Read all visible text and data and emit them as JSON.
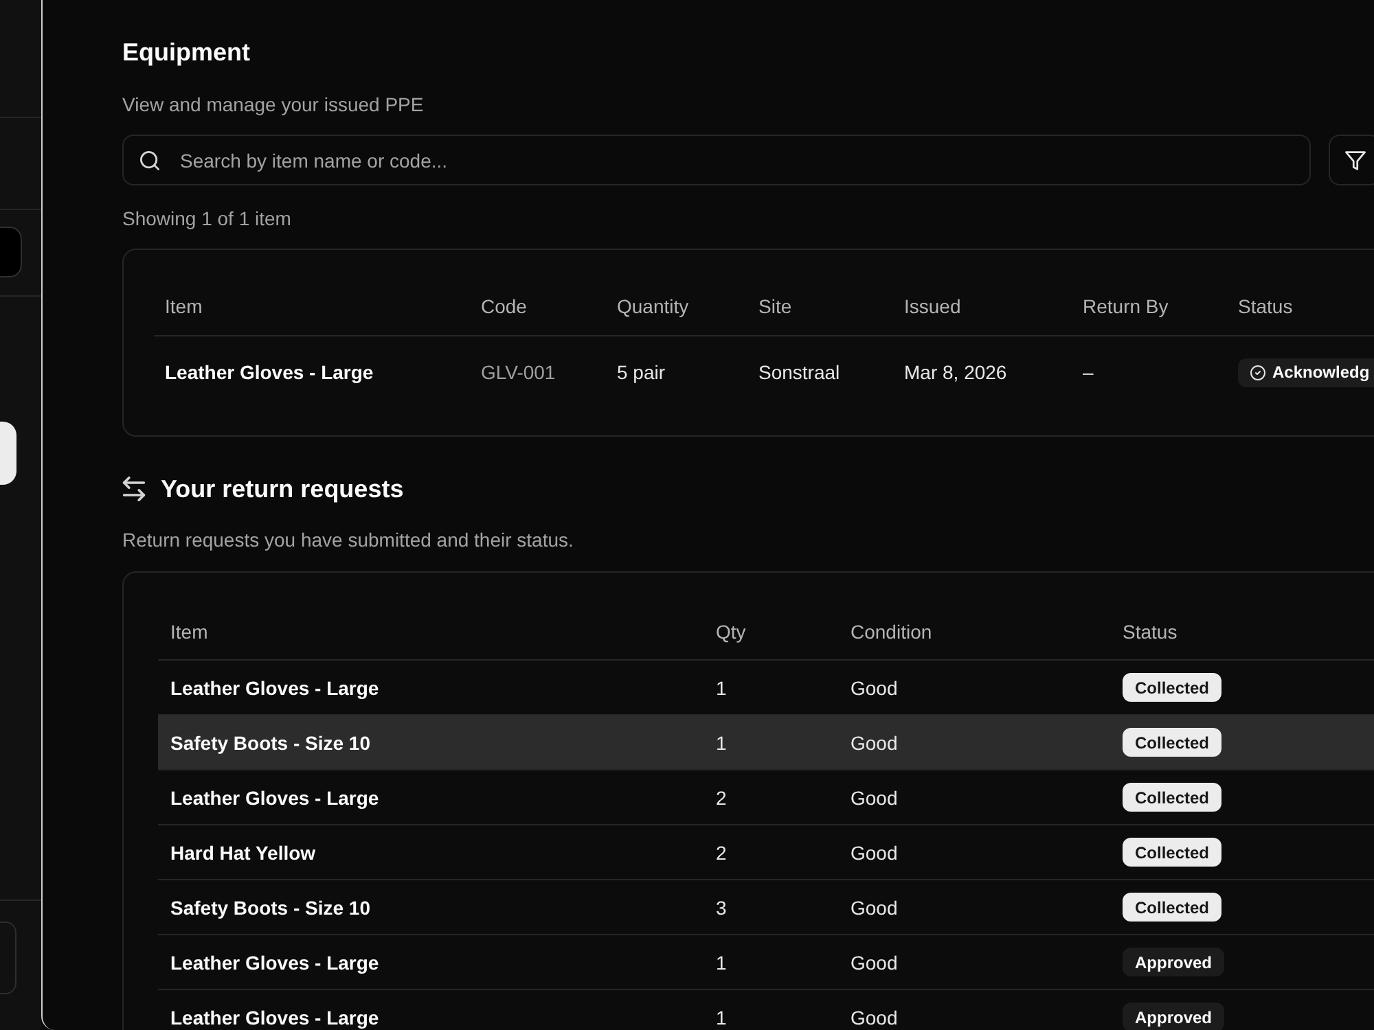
{
  "page": {
    "title": "Equipment",
    "subtitle": "View and manage your issued PPE"
  },
  "search": {
    "placeholder": "Search by item name or code..."
  },
  "result_count": "Showing 1 of 1 item",
  "equipment_table": {
    "columns": [
      "Item",
      "Code",
      "Quantity",
      "Site",
      "Issued",
      "Return By",
      "Status"
    ],
    "rows": [
      {
        "item": "Leather Gloves - Large",
        "code": "GLV-001",
        "quantity": "5 pair",
        "site": "Sonstraal",
        "issued": "Mar 8, 2026",
        "return_by": "–",
        "status": {
          "label": "Acknowledg",
          "kind": "acknowledged"
        }
      }
    ]
  },
  "returns": {
    "title": "Your return requests",
    "subtitle": "Return requests you have submitted and their status.",
    "table": {
      "columns": [
        "Item",
        "Qty",
        "Condition",
        "Status"
      ],
      "rows": [
        {
          "item": "Leather Gloves - Large",
          "qty": "1",
          "condition": "Good",
          "highlighted": false,
          "status": {
            "label": "Collected",
            "kind": "collected"
          }
        },
        {
          "item": "Safety Boots - Size 10",
          "qty": "1",
          "condition": "Good",
          "highlighted": true,
          "status": {
            "label": "Collected",
            "kind": "collected"
          }
        },
        {
          "item": "Leather Gloves - Large",
          "qty": "2",
          "condition": "Good",
          "highlighted": false,
          "status": {
            "label": "Collected",
            "kind": "collected"
          }
        },
        {
          "item": "Hard Hat Yellow",
          "qty": "2",
          "condition": "Good",
          "highlighted": false,
          "status": {
            "label": "Collected",
            "kind": "collected"
          }
        },
        {
          "item": "Safety Boots - Size 10",
          "qty": "3",
          "condition": "Good",
          "highlighted": false,
          "status": {
            "label": "Collected",
            "kind": "collected"
          }
        },
        {
          "item": "Leather Gloves - Large",
          "qty": "1",
          "condition": "Good",
          "highlighted": false,
          "status": {
            "label": "Approved",
            "kind": "approved"
          }
        },
        {
          "item": "Leather Gloves - Large",
          "qty": "1",
          "condition": "Good",
          "highlighted": false,
          "status": {
            "label": "Approved",
            "kind": "approved"
          }
        }
      ]
    }
  }
}
